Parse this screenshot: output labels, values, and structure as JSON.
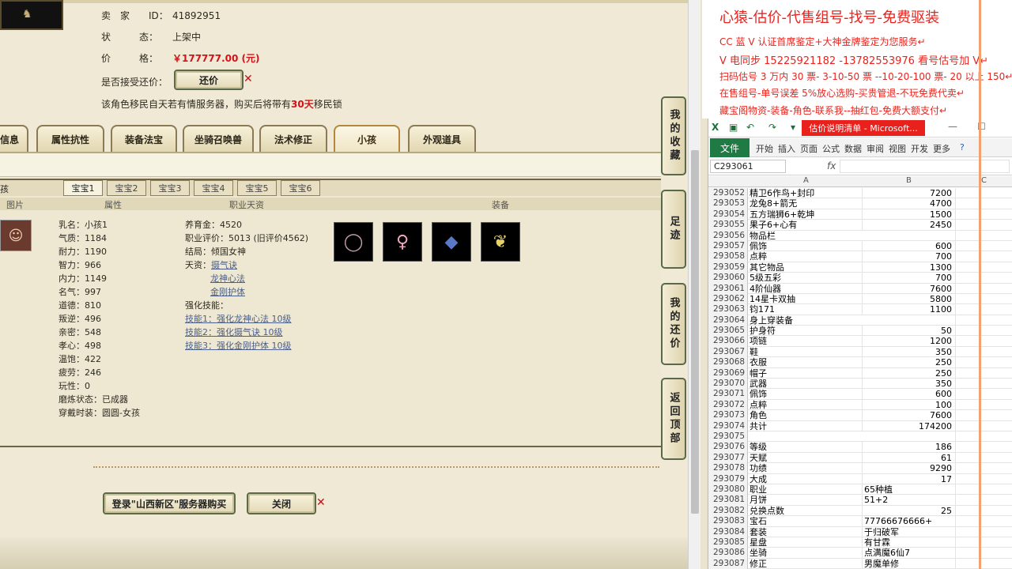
{
  "seller": {
    "id_label": "卖　家　　ID：",
    "id_value": "41892951",
    "status_label": "状　　　态：",
    "status_value": "上架中",
    "price_label": "价　　　格：",
    "price_value": "￥177777.00 (元)",
    "bargain_label": "是否接受还价：",
    "bargain_button": "还价",
    "migrate_prefix": "该角色移民自天若有情服务器，购买后将带有",
    "migrate_days": "30天",
    "migrate_suffix": "移民锁"
  },
  "main_tabs": [
    "信息",
    "属性抗性",
    "装备法宝",
    "坐骑召唤兽",
    "法术修正",
    "小孩",
    "外观道具"
  ],
  "sub_panel": {
    "child_label": "孩",
    "pet_tabs": [
      "宝宝1",
      "宝宝2",
      "宝宝3",
      "宝宝4",
      "宝宝5",
      "宝宝6"
    ],
    "col_headers": {
      "image": "图片",
      "attributes": "属性",
      "career": "职业天资",
      "equipment": "装备"
    }
  },
  "child_attrs": [
    "乳名：小孩1",
    "气质：1184",
    "耐力：1190",
    "智力：966",
    "内力：1149",
    "名气：997",
    "道德：810",
    "叛逆：496",
    "亲密：548",
    "孝心：498",
    "温饱：422",
    "疲劳：246",
    "玩性：0",
    "磨炼状态：已成器",
    "穿戴时装：圆圆-女孩"
  ],
  "child_career": {
    "nurture": "养育金：4520",
    "rating": "职业评价：5013 (旧评价4562)",
    "ending": "结局：倾国女神",
    "talent_label": "天资：",
    "talents": [
      "摄气诀",
      "龙神心法",
      "金刚护体"
    ],
    "enhance_label": "强化技能：",
    "enhance_skills": [
      "技能1：强化龙神心法 10级",
      "技能2：强化摄气诀 10级",
      "技能3：强化金刚护体 10级"
    ]
  },
  "equipment_icons": [
    "necklace-icon",
    "dress-icon",
    "book-icon",
    "shoes-icon"
  ],
  "bottom_buttons": {
    "buy": "登录\"山西新区\"服务器购买",
    "close": "关闭"
  },
  "side_buttons": [
    "我的收藏",
    "足迹",
    "我的还价",
    "返回顶部"
  ],
  "promo": {
    "title": "心猿-估价-代售组号-找号-免费驱装",
    "lines": [
      "CC 蓝 V 认证首席鉴定+大神金牌鉴定为您服务↵",
      "V 电同步 15225921182 -13782553976 看号估号加 V↵",
      "扫码估号 3 万内 30 票- 3-10-50 票 --10-20-100 票- 20 以上 150↵",
      "在售组号-单号误差 5%放心选购-买贵管退-不玩免费代卖↵",
      "藏宝阁物资-装备-角色-联系我--抽红包-免费大额支付↵"
    ]
  },
  "excel": {
    "title_tab": "估价说明清单 - Microsoft...",
    "ribbon_file": "文件",
    "ribbon_tabs": [
      "开始",
      "插入",
      "页面",
      "公式",
      "数据",
      "审阅",
      "视图",
      "开发",
      "更多"
    ],
    "name_box": "C293061",
    "fx": "fx",
    "col_a": "A",
    "col_b": "B",
    "col_c": "C",
    "rows": [
      [
        "293052",
        "精卫6作鸟+封印",
        "7200"
      ],
      [
        "293053",
        "龙兔8+箭无",
        "4700"
      ],
      [
        "293054",
        "五方瑞狮6+乾坤",
        "1500"
      ],
      [
        "293055",
        "果子6+心有",
        "2450"
      ],
      [
        "293056",
        "物品栏",
        ""
      ],
      [
        "293057",
        "佩饰",
        "600"
      ],
      [
        "293058",
        "点粹",
        "700"
      ],
      [
        "293059",
        "其它物品",
        "1300"
      ],
      [
        "293060",
        "5级五彩",
        "700"
      ],
      [
        "293061",
        "4阶仙器",
        "7600"
      ],
      [
        "293062",
        "14星卡双抽",
        "5800"
      ],
      [
        "293063",
        "钧171",
        "1100"
      ],
      [
        "293064",
        "身上穿装备",
        ""
      ],
      [
        "293065",
        "护身符",
        "50"
      ],
      [
        "293066",
        "项链",
        "1200"
      ],
      [
        "293067",
        "鞋",
        "350"
      ],
      [
        "293068",
        "衣服",
        "250"
      ],
      [
        "293069",
        "帽子",
        "250"
      ],
      [
        "293070",
        "武器",
        "350"
      ],
      [
        "293071",
        "佩饰",
        "600"
      ],
      [
        "293072",
        "点粹",
        "100"
      ],
      [
        "293073",
        "角色",
        "7600"
      ],
      [
        "293074",
        "共计",
        "174200"
      ],
      [
        "293075",
        "",
        ""
      ],
      [
        "293076",
        "等级",
        "186"
      ],
      [
        "293077",
        "天赋",
        "61"
      ],
      [
        "293078",
        "功绩",
        "9290"
      ],
      [
        "293079",
        "大成",
        "17"
      ],
      [
        "293080",
        "职业",
        "65种植"
      ],
      [
        "293081",
        "月饼",
        "51+2"
      ],
      [
        "293082",
        "兑换点数",
        "25"
      ],
      [
        "293083",
        "宝石",
        "77766676666+"
      ],
      [
        "293084",
        "套装",
        "于归破军"
      ],
      [
        "293085",
        "星盘",
        "有甘霖"
      ],
      [
        "293086",
        "坐骑",
        "点满魔6仙7"
      ],
      [
        "293087",
        "修正",
        "男魔单修"
      ]
    ]
  }
}
